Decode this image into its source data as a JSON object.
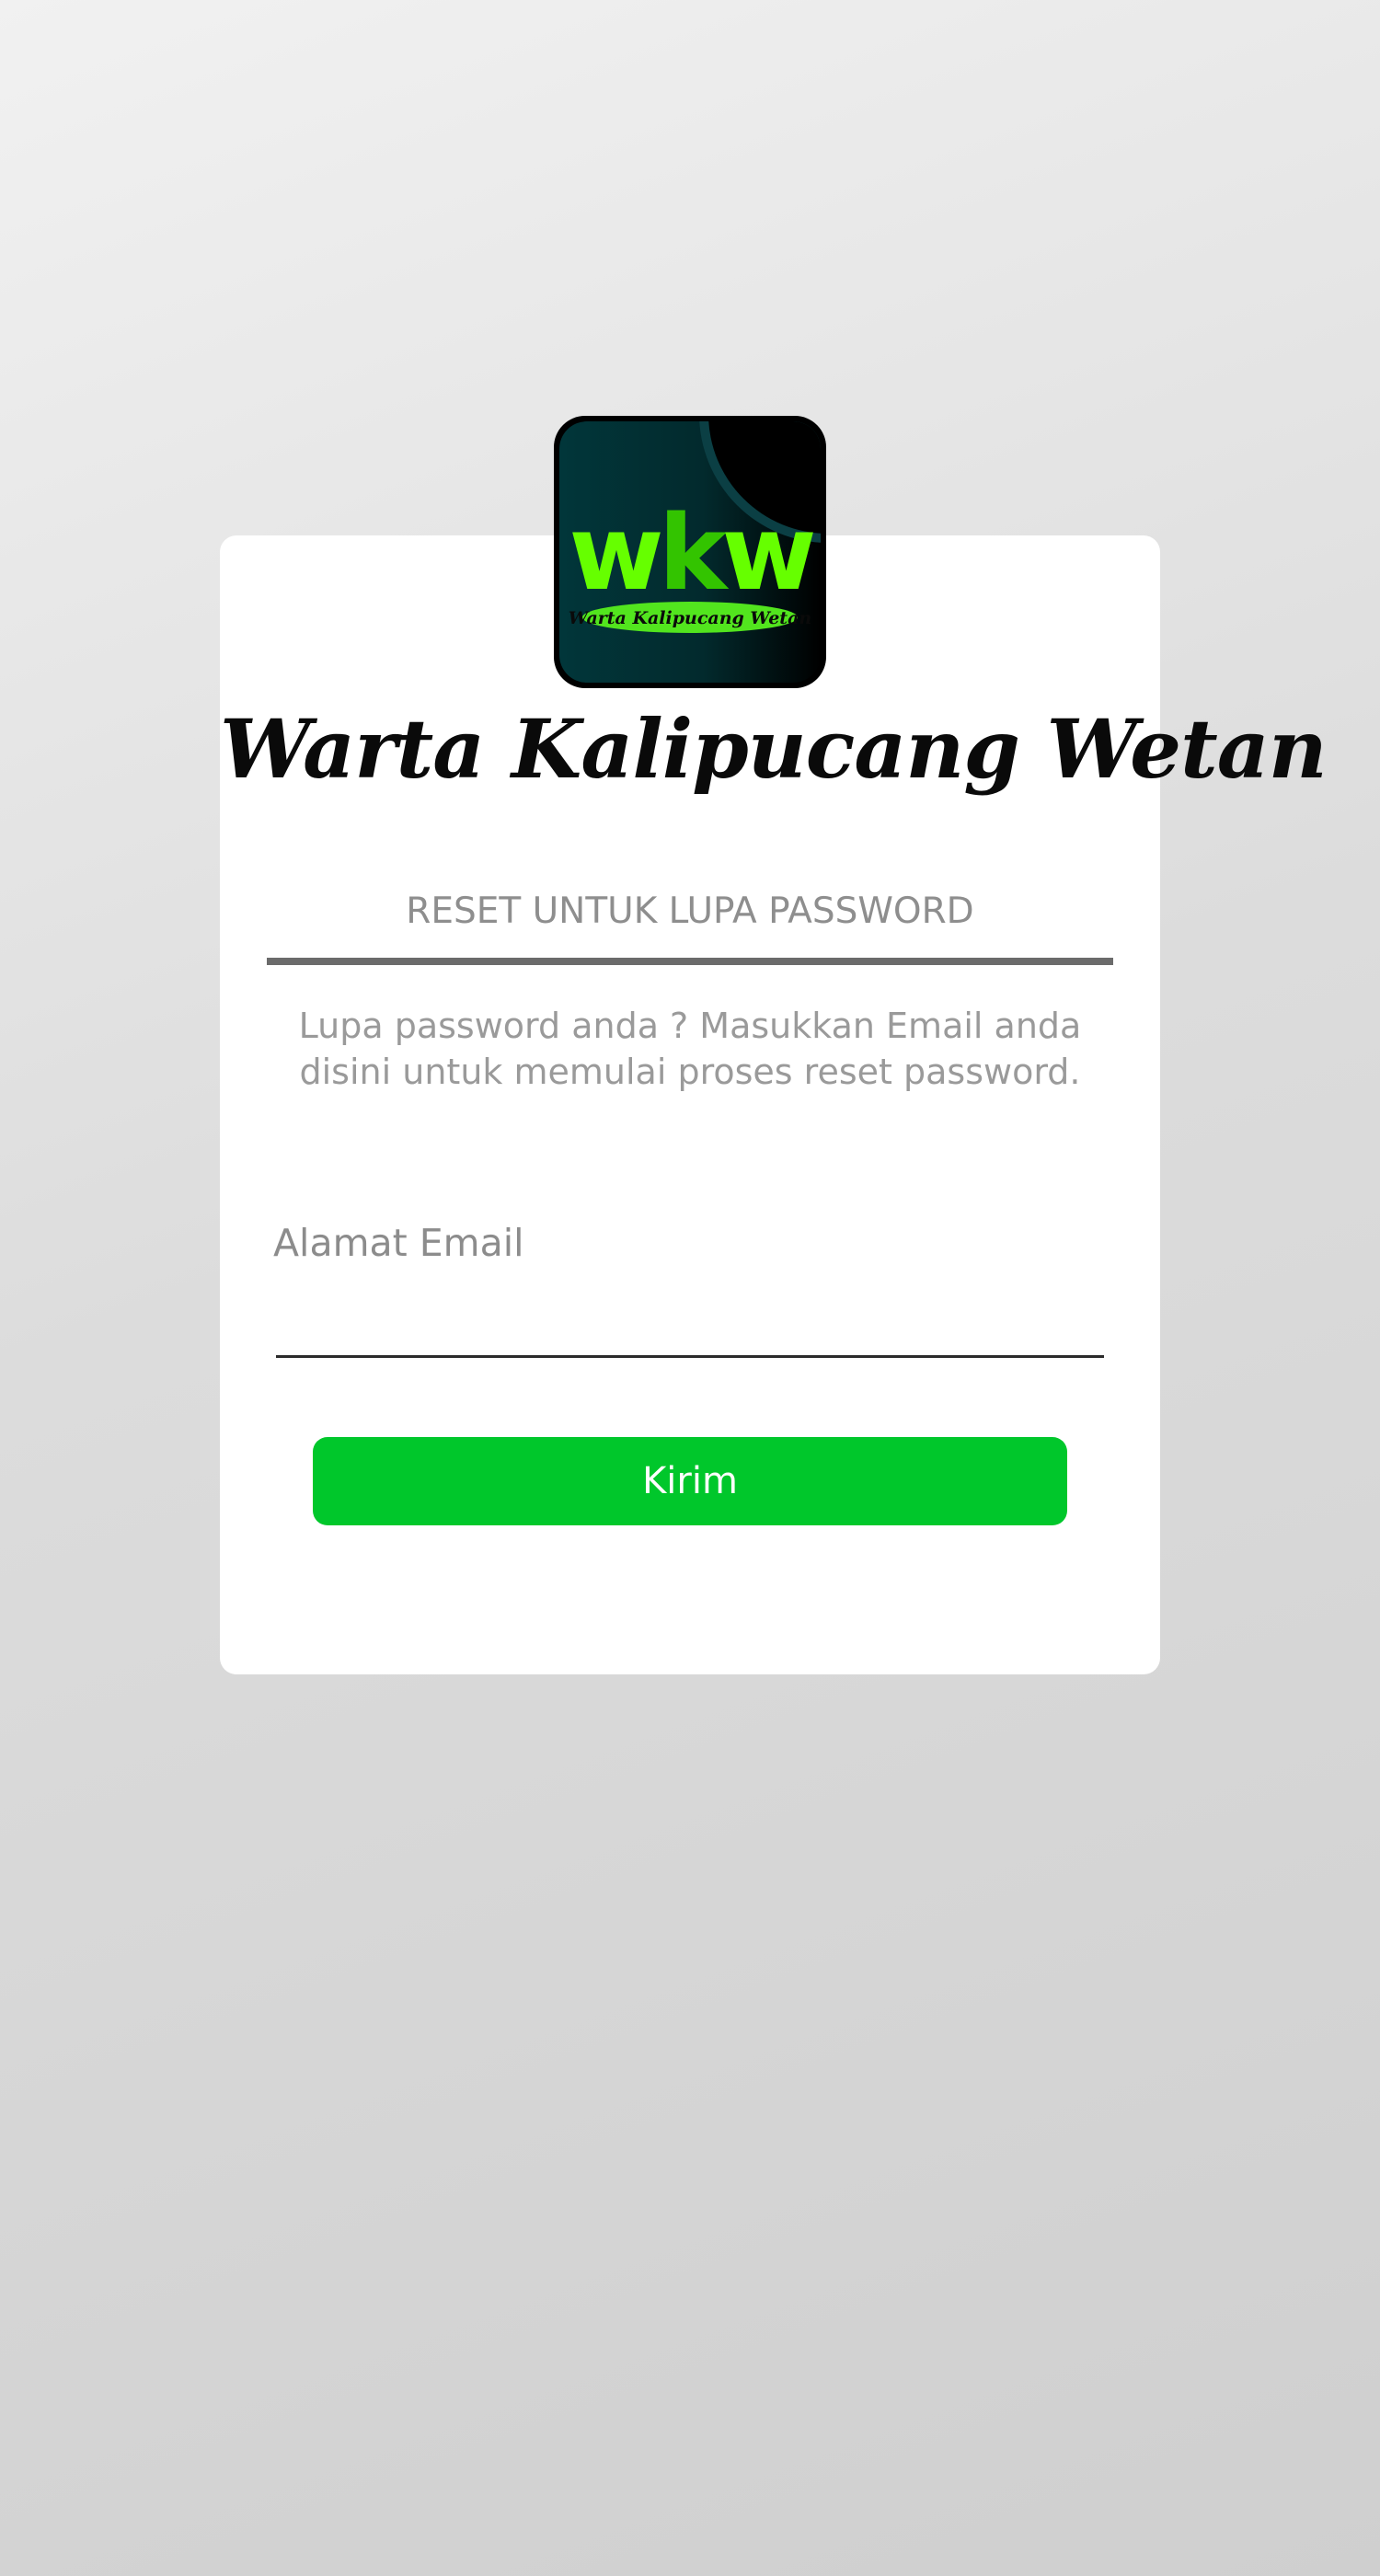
{
  "logo": {
    "letters": [
      "w",
      "k",
      "w"
    ],
    "caption": "Warta Kalipucang Wetan",
    "colors": {
      "background_dark": "#01363a",
      "background_black": "#000000",
      "letters_green": "#66ff00",
      "letter_k_green": "#33c400",
      "pill_green": "#52e51e"
    }
  },
  "brand": {
    "title": "Warta Kalipucang Wetan"
  },
  "reset": {
    "heading": "RESET UNTUK LUPA PASSWORD",
    "description": "Lupa password anda ? Masukkan Email anda disini untuk memulai proses reset password."
  },
  "form": {
    "email_label": "Alamat Email",
    "email_value": "",
    "submit_label": "Kirim"
  },
  "colors": {
    "accent": "#00c72b",
    "card": "#ffffff",
    "muted_text": "#9a9a9a"
  }
}
